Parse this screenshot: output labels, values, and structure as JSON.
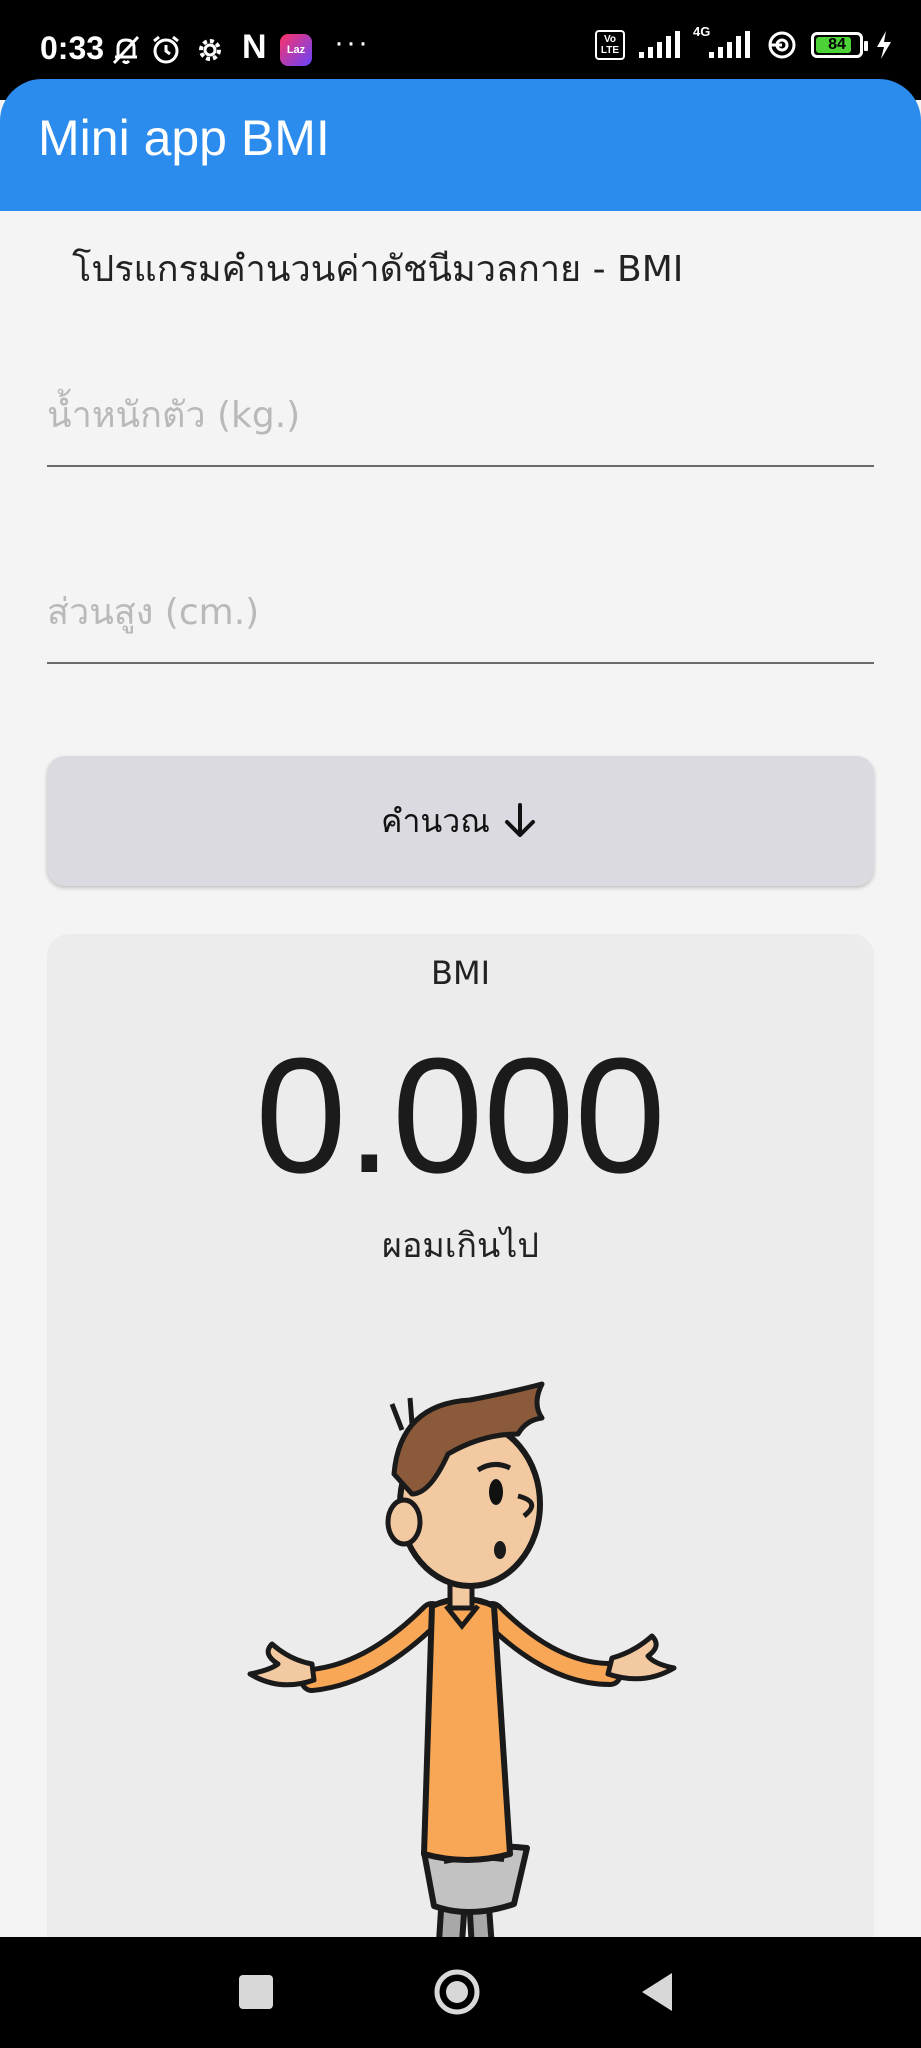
{
  "status_bar": {
    "time": "0:33",
    "battery_level": 84,
    "network": "4G",
    "icons": [
      "mute-icon",
      "alarm-icon",
      "settings-icon",
      "netflix-icon",
      "lazada-icon",
      "more-icon",
      "volte-icon",
      "signal-icon",
      "signal-4g-icon",
      "data-saver-icon",
      "battery-icon",
      "charging-icon"
    ],
    "left_icon_labels": {
      "netflix": "N",
      "lazada": "Laz",
      "more": "···",
      "volte": "Vo LTE"
    }
  },
  "app_bar": {
    "title": "Mini app BMI",
    "color": "#2b8cee"
  },
  "subtitle": "โปรแกรมคำนวนค่าดัชนีมวลกาย - BMI",
  "weight_field": {
    "placeholder": "น้ำหนักตัว (kg.)",
    "value": ""
  },
  "height_field": {
    "placeholder": "ส่วนสูง (cm.)",
    "value": ""
  },
  "calculate_button": {
    "label": "คำนวณ",
    "icon": "arrow-down-icon"
  },
  "result": {
    "label": "BMI",
    "value": "0.000",
    "status": "ผอมเกินไป",
    "illustration": "thin-man-shrugging-illustration"
  },
  "nav_bar": {
    "buttons": [
      "recents-button",
      "home-button",
      "back-button"
    ]
  }
}
